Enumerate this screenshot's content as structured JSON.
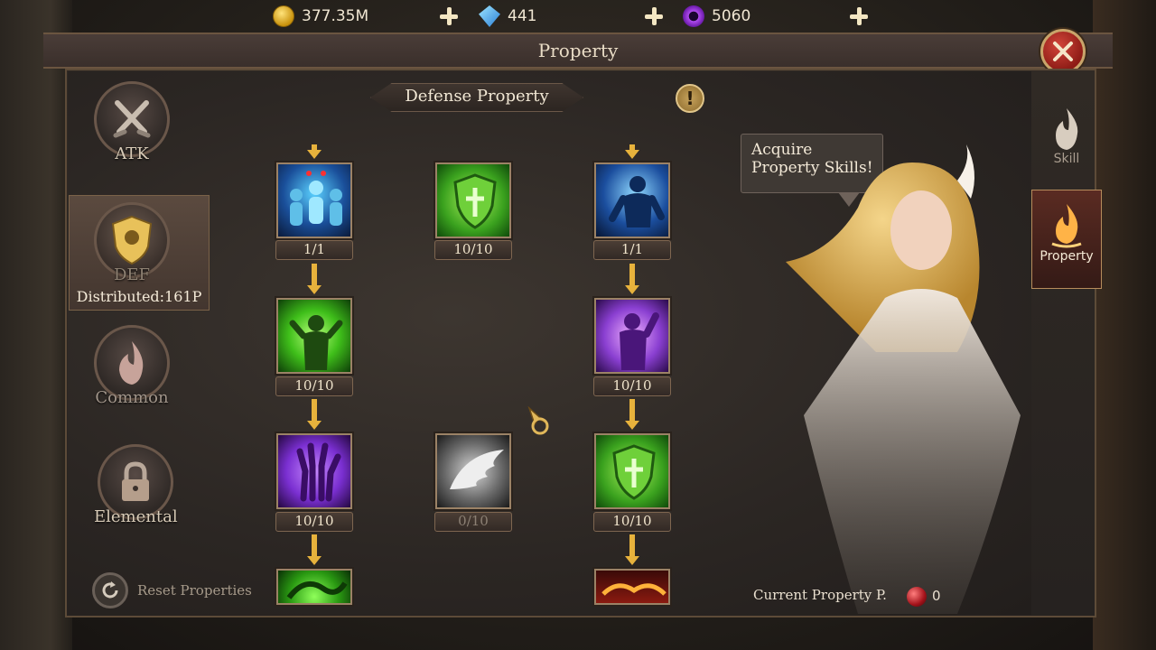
{
  "currency": {
    "gold": "377.35M",
    "diamond": "441",
    "crystal": "5060"
  },
  "window": {
    "title": "Property"
  },
  "left_tabs": {
    "atk": "ATK",
    "def": "DEF",
    "distributed": "Distributed:161P",
    "common": "Common",
    "elemental": "Elemental",
    "reset": "Reset Properties"
  },
  "section": {
    "title": "Defense Property"
  },
  "nodes": {
    "c1r1": "1/1",
    "c2r1": "10/10",
    "c3r1": "1/1",
    "c1r2": "10/10",
    "c3r2": "10/10",
    "c1r3": "10/10",
    "c2r3": "0/10",
    "c3r3": "10/10"
  },
  "tooltip": {
    "text": "Acquire Property Skills!"
  },
  "side_tabs": {
    "skill": "Skill",
    "property": "Property"
  },
  "points": {
    "label": "Current Property P.",
    "value": "0"
  },
  "colors": {
    "accent_gold": "#c9a46a",
    "close_red": "#b42a22",
    "node_green": "#4fc12a",
    "node_blue": "#2f7ed8",
    "node_purple": "#8a3fd1"
  }
}
